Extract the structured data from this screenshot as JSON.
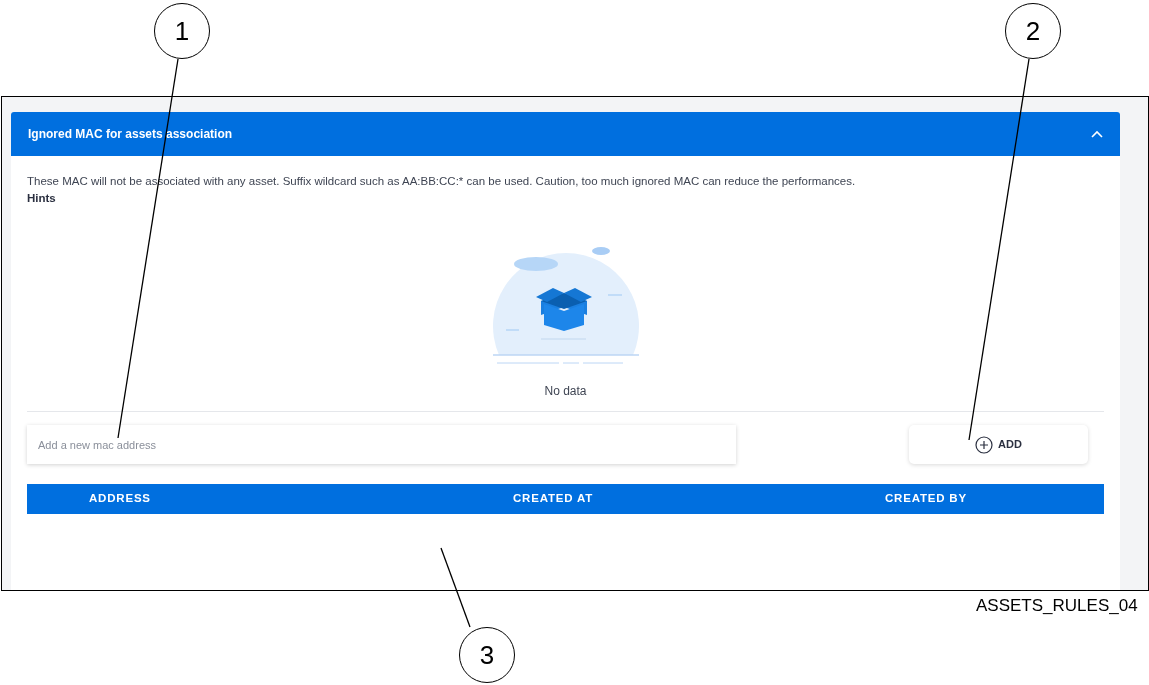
{
  "panel": {
    "title": "Ignored MAC for assets association",
    "expanded": true,
    "description": "These MAC will not be associated with any asset. Suffix wildcard such as AA:BB:CC:* can be used. Caution, too much ignored MAC can reduce the performances.",
    "hints": "Hints",
    "empty_text": "No data",
    "input": {
      "placeholder": "Add a new mac address"
    },
    "add_button": "ADD",
    "table": {
      "columns": [
        "ADDRESS",
        "CREATED AT",
        "CREATED BY"
      ]
    }
  },
  "callouts": [
    {
      "label": "1"
    },
    {
      "label": "2"
    },
    {
      "label": "3"
    }
  ],
  "caption": "ASSETS_RULES_04"
}
